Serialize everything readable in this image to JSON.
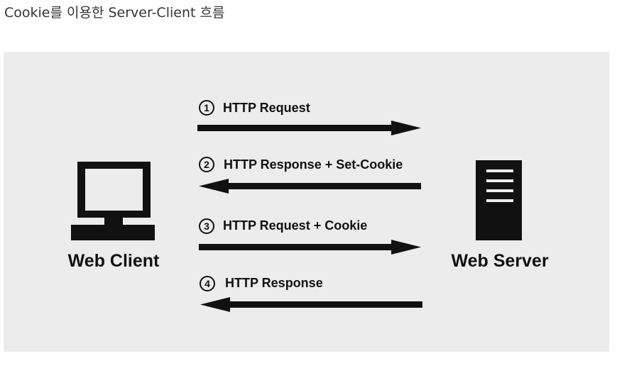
{
  "caption": "Cookie를 이용한 Server-Client 흐름",
  "diagram": {
    "background": "#ececec",
    "ink": "#111111",
    "client_label": "Web Client",
    "server_label": "Web Server",
    "messages": [
      {
        "step": "1",
        "label": "HTTP Request",
        "direction": "to-server"
      },
      {
        "step": "2",
        "label": "HTTP Response + Set-Cookie",
        "direction": "to-client"
      },
      {
        "step": "3",
        "label": "HTTP Request + Cookie",
        "direction": "to-server"
      },
      {
        "step": "4",
        "label": "HTTP Response",
        "direction": "to-client"
      }
    ]
  }
}
